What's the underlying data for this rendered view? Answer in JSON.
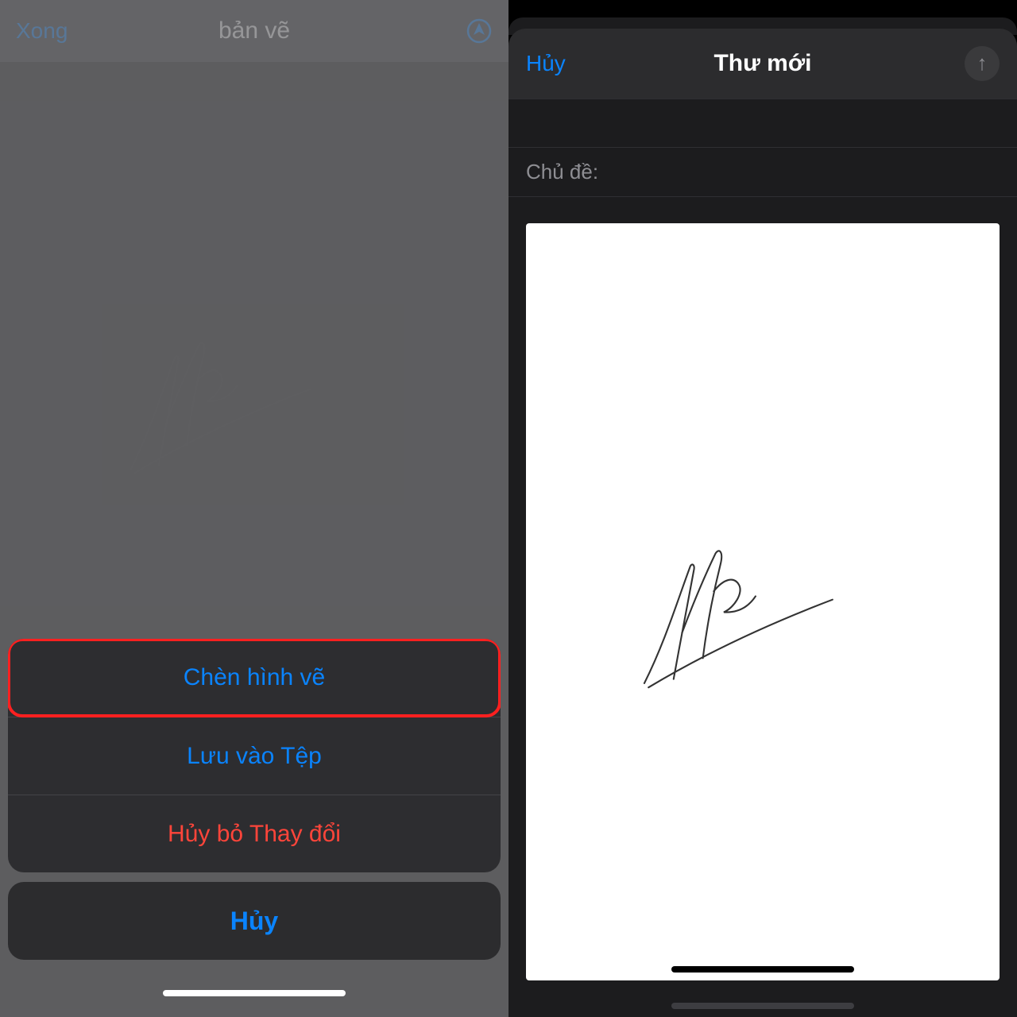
{
  "left": {
    "nav": {
      "done": "Xong",
      "title": "bản vẽ"
    },
    "sheet": {
      "insert": "Chèn hình vẽ",
      "save": "Lưu vào Tệp",
      "discard": "Hủy bỏ Thay đổi",
      "cancel": "Hủy"
    }
  },
  "right": {
    "nav": {
      "cancel": "Hủy",
      "title": "Thư mới"
    },
    "fields": {
      "subject_label": "Chủ đề:"
    }
  }
}
